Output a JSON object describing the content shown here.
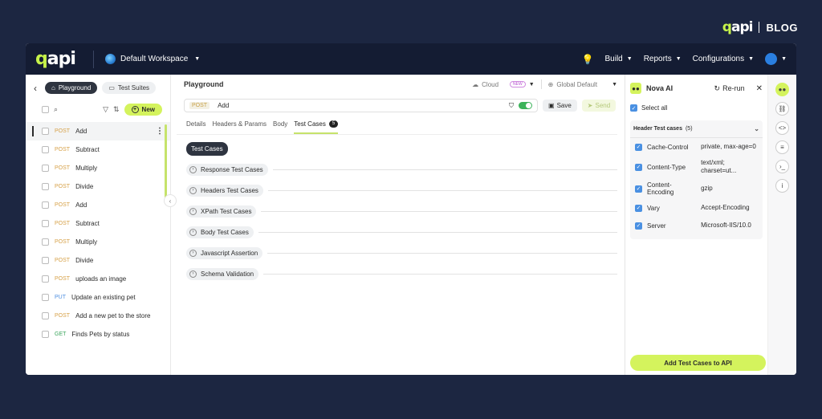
{
  "brand": {
    "logo": "qapi",
    "blog": "BLOG"
  },
  "topbar": {
    "logo": "qapi",
    "workspace": "Default Workspace",
    "nav": [
      "Build",
      "Reports",
      "Configurations"
    ]
  },
  "sidebar": {
    "tabs": {
      "playground": "Playground",
      "test_suites": "Test Suites"
    },
    "new_label": "New",
    "items": [
      {
        "method": "POST",
        "name": "Add"
      },
      {
        "method": "POST",
        "name": "Subtract"
      },
      {
        "method": "POST",
        "name": "Multiply"
      },
      {
        "method": "POST",
        "name": "Divide"
      },
      {
        "method": "POST",
        "name": "Add"
      },
      {
        "method": "POST",
        "name": "Subtract"
      },
      {
        "method": "POST",
        "name": "Multiply"
      },
      {
        "method": "POST",
        "name": "Divide"
      },
      {
        "method": "POST",
        "name": "uploads an image"
      },
      {
        "method": "PUT",
        "name": "Update an existing pet"
      },
      {
        "method": "POST",
        "name": "Add a new pet to the store"
      },
      {
        "method": "GET",
        "name": "Finds Pets by status"
      }
    ]
  },
  "main": {
    "title": "Playground",
    "cloud": "Cloud",
    "new_tag": "NEW",
    "env": "Global Default",
    "request": {
      "method": "POST",
      "name": "Add"
    },
    "save": "Save",
    "send": "Send",
    "tabs": [
      "Details",
      "Headers & Params",
      "Body",
      "Test Cases"
    ],
    "test_cases_count": "5",
    "chip": "Test Cases",
    "sections": [
      "Response Test Cases",
      "Headers Test Cases",
      "XPath Test Cases",
      "Body Test Cases",
      "Javascript Assertion",
      "Schema Validation"
    ]
  },
  "ai": {
    "title": "Nova AI",
    "rerun": "Re-run",
    "select_all": "Select all",
    "group_title": "Header Test cases",
    "group_count": "(5)",
    "rows": [
      {
        "key": "Cache-Control",
        "value": "private, max-age=0"
      },
      {
        "key": "Content-Type",
        "value": "text/xml; charset=ut..."
      },
      {
        "key": "Content-Encoding",
        "value": "gzip"
      },
      {
        "key": "Vary",
        "value": "Accept-Encoding"
      },
      {
        "key": "Server",
        "value": "Microsoft-IIS/10.0"
      }
    ],
    "add_button": "Add Test Cases to API"
  }
}
